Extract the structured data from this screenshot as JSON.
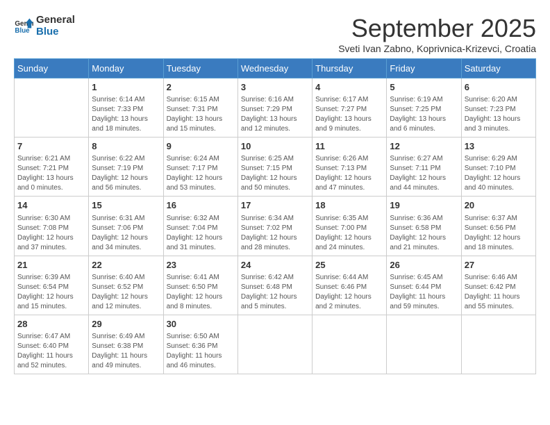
{
  "logo": {
    "line1": "General",
    "line2": "Blue"
  },
  "title": "September 2025",
  "subtitle": "Sveti Ivan Zabno, Koprivnica-Krizevci, Croatia",
  "days_header": [
    "Sunday",
    "Monday",
    "Tuesday",
    "Wednesday",
    "Thursday",
    "Friday",
    "Saturday"
  ],
  "weeks": [
    [
      {
        "day": "",
        "content": ""
      },
      {
        "day": "1",
        "content": "Sunrise: 6:14 AM\nSunset: 7:33 PM\nDaylight: 13 hours\nand 18 minutes."
      },
      {
        "day": "2",
        "content": "Sunrise: 6:15 AM\nSunset: 7:31 PM\nDaylight: 13 hours\nand 15 minutes."
      },
      {
        "day": "3",
        "content": "Sunrise: 6:16 AM\nSunset: 7:29 PM\nDaylight: 13 hours\nand 12 minutes."
      },
      {
        "day": "4",
        "content": "Sunrise: 6:17 AM\nSunset: 7:27 PM\nDaylight: 13 hours\nand 9 minutes."
      },
      {
        "day": "5",
        "content": "Sunrise: 6:19 AM\nSunset: 7:25 PM\nDaylight: 13 hours\nand 6 minutes."
      },
      {
        "day": "6",
        "content": "Sunrise: 6:20 AM\nSunset: 7:23 PM\nDaylight: 13 hours\nand 3 minutes."
      }
    ],
    [
      {
        "day": "7",
        "content": "Sunrise: 6:21 AM\nSunset: 7:21 PM\nDaylight: 13 hours\nand 0 minutes."
      },
      {
        "day": "8",
        "content": "Sunrise: 6:22 AM\nSunset: 7:19 PM\nDaylight: 12 hours\nand 56 minutes."
      },
      {
        "day": "9",
        "content": "Sunrise: 6:24 AM\nSunset: 7:17 PM\nDaylight: 12 hours\nand 53 minutes."
      },
      {
        "day": "10",
        "content": "Sunrise: 6:25 AM\nSunset: 7:15 PM\nDaylight: 12 hours\nand 50 minutes."
      },
      {
        "day": "11",
        "content": "Sunrise: 6:26 AM\nSunset: 7:13 PM\nDaylight: 12 hours\nand 47 minutes."
      },
      {
        "day": "12",
        "content": "Sunrise: 6:27 AM\nSunset: 7:11 PM\nDaylight: 12 hours\nand 44 minutes."
      },
      {
        "day": "13",
        "content": "Sunrise: 6:29 AM\nSunset: 7:10 PM\nDaylight: 12 hours\nand 40 minutes."
      }
    ],
    [
      {
        "day": "14",
        "content": "Sunrise: 6:30 AM\nSunset: 7:08 PM\nDaylight: 12 hours\nand 37 minutes."
      },
      {
        "day": "15",
        "content": "Sunrise: 6:31 AM\nSunset: 7:06 PM\nDaylight: 12 hours\nand 34 minutes."
      },
      {
        "day": "16",
        "content": "Sunrise: 6:32 AM\nSunset: 7:04 PM\nDaylight: 12 hours\nand 31 minutes."
      },
      {
        "day": "17",
        "content": "Sunrise: 6:34 AM\nSunset: 7:02 PM\nDaylight: 12 hours\nand 28 minutes."
      },
      {
        "day": "18",
        "content": "Sunrise: 6:35 AM\nSunset: 7:00 PM\nDaylight: 12 hours\nand 24 minutes."
      },
      {
        "day": "19",
        "content": "Sunrise: 6:36 AM\nSunset: 6:58 PM\nDaylight: 12 hours\nand 21 minutes."
      },
      {
        "day": "20",
        "content": "Sunrise: 6:37 AM\nSunset: 6:56 PM\nDaylight: 12 hours\nand 18 minutes."
      }
    ],
    [
      {
        "day": "21",
        "content": "Sunrise: 6:39 AM\nSunset: 6:54 PM\nDaylight: 12 hours\nand 15 minutes."
      },
      {
        "day": "22",
        "content": "Sunrise: 6:40 AM\nSunset: 6:52 PM\nDaylight: 12 hours\nand 12 minutes."
      },
      {
        "day": "23",
        "content": "Sunrise: 6:41 AM\nSunset: 6:50 PM\nDaylight: 12 hours\nand 8 minutes."
      },
      {
        "day": "24",
        "content": "Sunrise: 6:42 AM\nSunset: 6:48 PM\nDaylight: 12 hours\nand 5 minutes."
      },
      {
        "day": "25",
        "content": "Sunrise: 6:44 AM\nSunset: 6:46 PM\nDaylight: 12 hours\nand 2 minutes."
      },
      {
        "day": "26",
        "content": "Sunrise: 6:45 AM\nSunset: 6:44 PM\nDaylight: 11 hours\nand 59 minutes."
      },
      {
        "day": "27",
        "content": "Sunrise: 6:46 AM\nSunset: 6:42 PM\nDaylight: 11 hours\nand 55 minutes."
      }
    ],
    [
      {
        "day": "28",
        "content": "Sunrise: 6:47 AM\nSunset: 6:40 PM\nDaylight: 11 hours\nand 52 minutes."
      },
      {
        "day": "29",
        "content": "Sunrise: 6:49 AM\nSunset: 6:38 PM\nDaylight: 11 hours\nand 49 minutes."
      },
      {
        "day": "30",
        "content": "Sunrise: 6:50 AM\nSunset: 6:36 PM\nDaylight: 11 hours\nand 46 minutes."
      },
      {
        "day": "",
        "content": ""
      },
      {
        "day": "",
        "content": ""
      },
      {
        "day": "",
        "content": ""
      },
      {
        "day": "",
        "content": ""
      }
    ]
  ]
}
